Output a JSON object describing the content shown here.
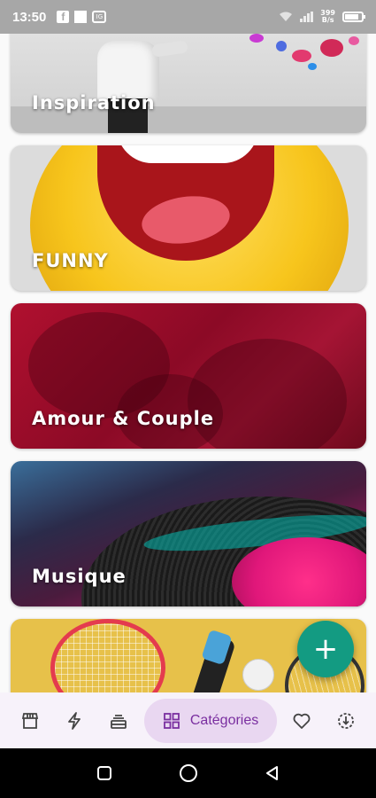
{
  "status_bar": {
    "time": "13:50",
    "facebook_glyph": "f",
    "instagram_glyph": "IG",
    "speed_line1": "399",
    "speed_line2": "B/s",
    "battery_level": 0.85
  },
  "categories": [
    {
      "label": "Inspiration"
    },
    {
      "label": "FUNNY"
    },
    {
      "label": "Amour & Couple"
    },
    {
      "label": "Musique"
    },
    {
      "label": ""
    }
  ],
  "fab": {
    "icon": "plus-icon",
    "glyph": "+"
  },
  "bottom_nav": {
    "items": [
      {
        "icon": "store-icon"
      },
      {
        "icon": "lightning-icon"
      },
      {
        "icon": "stack-icon"
      },
      {
        "icon": "grid-icon",
        "label": "Catégories",
        "active": true
      },
      {
        "icon": "heart-icon"
      },
      {
        "icon": "download-icon"
      }
    ],
    "active_color": "#7a2fa0",
    "active_bg": "#e9d7f1"
  },
  "system_nav": {
    "items": [
      "recents-icon",
      "home-icon",
      "back-icon"
    ]
  },
  "colors": {
    "fab": "#139b82",
    "status_bar": "#a7a7a7"
  }
}
